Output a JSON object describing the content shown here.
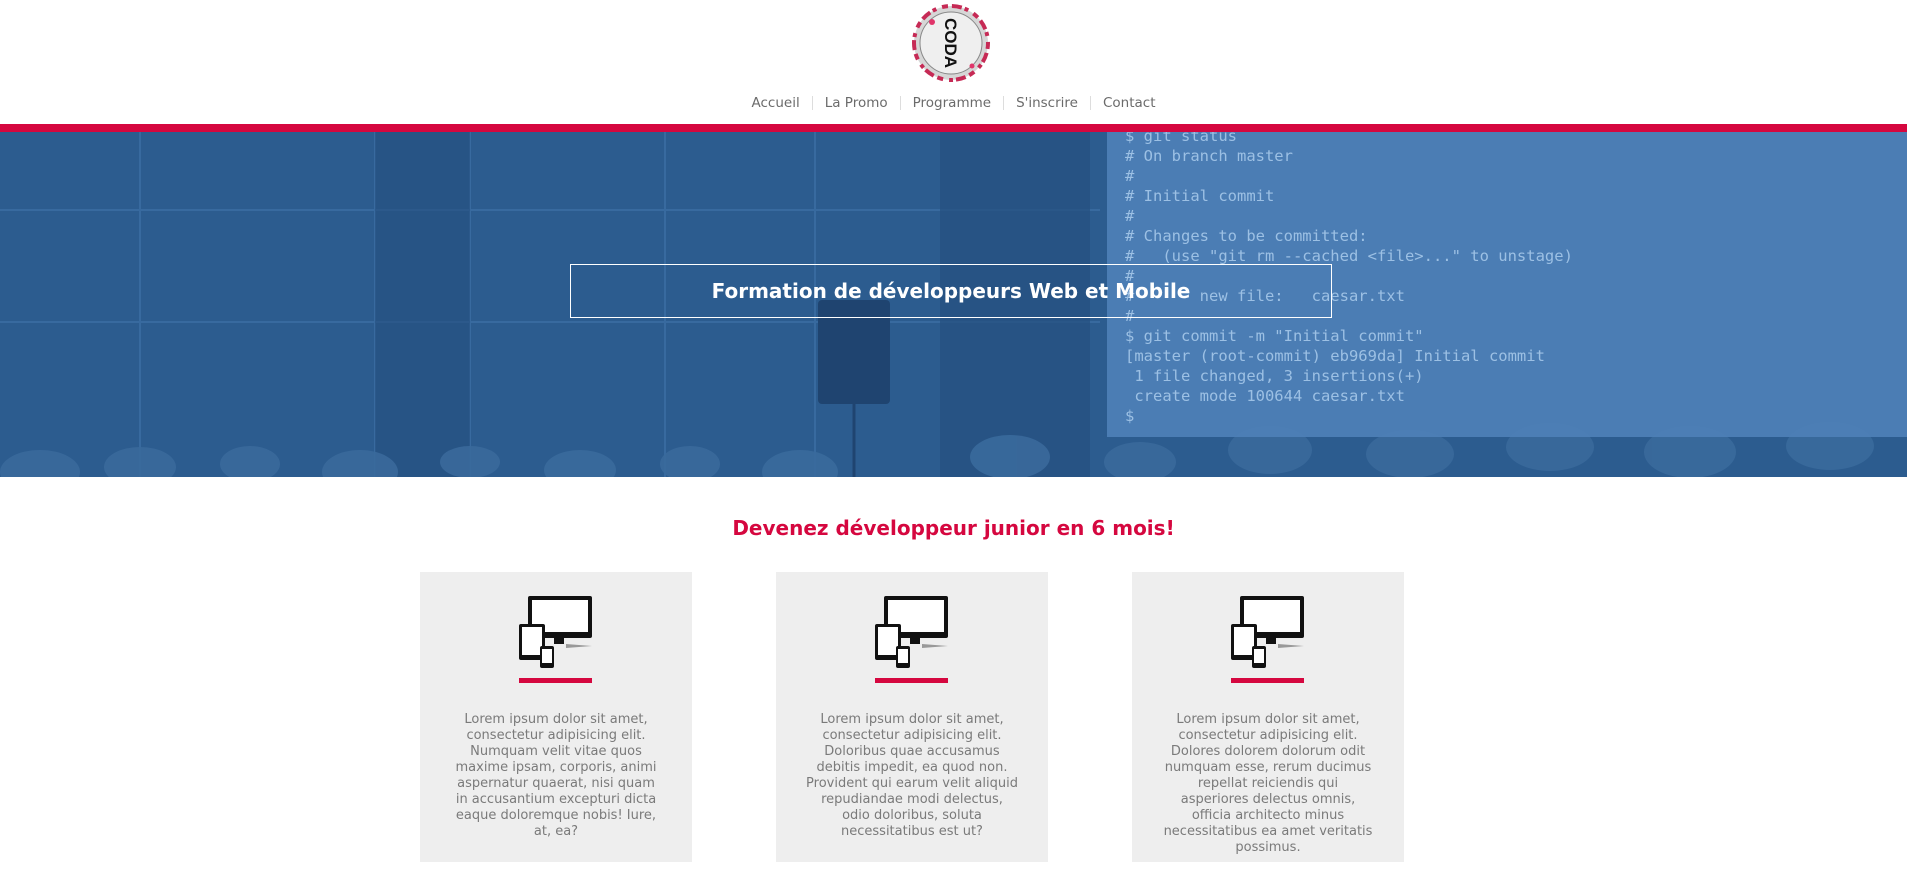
{
  "header": {
    "logo_alt": "CODA",
    "nav": [
      {
        "label": "Accueil"
      },
      {
        "label": "La Promo"
      },
      {
        "label": "Programme"
      },
      {
        "label": "S'inscrire"
      },
      {
        "label": "Contact"
      }
    ]
  },
  "hero": {
    "title": "Formation de développeurs Web et Mobile",
    "terminal_lines": [
      "$ git status",
      "# On branch master",
      "#",
      "# Initial commit",
      "#",
      "# Changes to be committed:",
      "#   (use \"git rm --cached <file>...\" to unstage)",
      "#",
      "#       new file:   caesar.txt",
      "#",
      "$ git commit -m \"Initial commit\"",
      "[master (root-commit) eb969da] Initial commit",
      " 1 file changed, 3 insertions(+)",
      " create mode 100644 caesar.txt",
      "$ "
    ]
  },
  "main": {
    "tagline": "Devenez développeur junior en 6 mois!",
    "cards": [
      {
        "icon": "devices-icon",
        "text": "Lorem ipsum dolor sit amet, consectetur adipisicing elit. Numquam velit vitae quos maxime ipsam, corporis, animi aspernatur quaerat, nisi quam in accusantium excepturi dicta eaque doloremque nobis! Iure, at, ea?"
      },
      {
        "icon": "devices-icon",
        "text": "Lorem ipsum dolor sit amet, consectetur adipisicing elit. Doloribus quae accusamus debitis impedit, ea quod non. Provident qui earum velit aliquid repudiandae modi delectus, odio doloribus, soluta necessitatibus est ut?"
      },
      {
        "icon": "devices-icon",
        "text": "Lorem ipsum dolor sit amet, consectetur adipisicing elit. Dolores dolorem dolorum odit numquam esse, rerum ducimus repellat reiciendis qui asperiores delectus omnis, officia architecto minus necessitatibus ea amet veritatis possimus."
      }
    ]
  },
  "colors": {
    "accent": "#d5073f",
    "hero_blue": "#2e5f93",
    "card_bg": "#eeeeee",
    "nav_text": "#6b6b6b"
  }
}
